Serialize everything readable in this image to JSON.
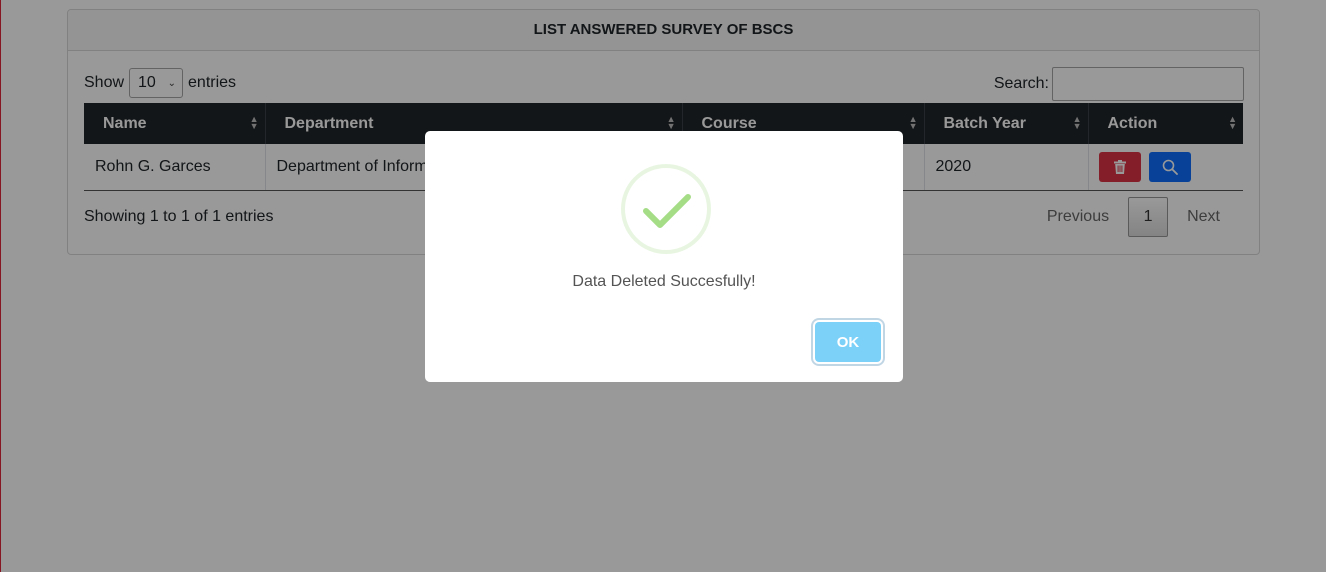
{
  "card": {
    "title": "LIST ANSWERED SURVEY OF BSCS"
  },
  "controls": {
    "show_label": "Show",
    "entries_value": "10",
    "entries_label": "entries",
    "search_label": "Search:",
    "search_value": ""
  },
  "table": {
    "columns": [
      "Name",
      "Department",
      "Course",
      "Batch Year",
      "Action"
    ],
    "rows": [
      {
        "name": "Rohn G. Garces",
        "department": "Department of Inform",
        "course": "",
        "batch_year": "2020"
      }
    ]
  },
  "footer": {
    "info": "Showing 1 to 1 of 1 entries",
    "previous": "Previous",
    "current_page": "1",
    "next": "Next"
  },
  "modal": {
    "message": "Data Deleted Succesfully!",
    "ok_label": "OK",
    "icon": "check-icon"
  },
  "colors": {
    "header_dark": "#212529",
    "delete_button": "#dc3545",
    "view_button": "#0d6efd",
    "ok_button": "#7cd1f9",
    "success_check": "#a5dc86"
  }
}
